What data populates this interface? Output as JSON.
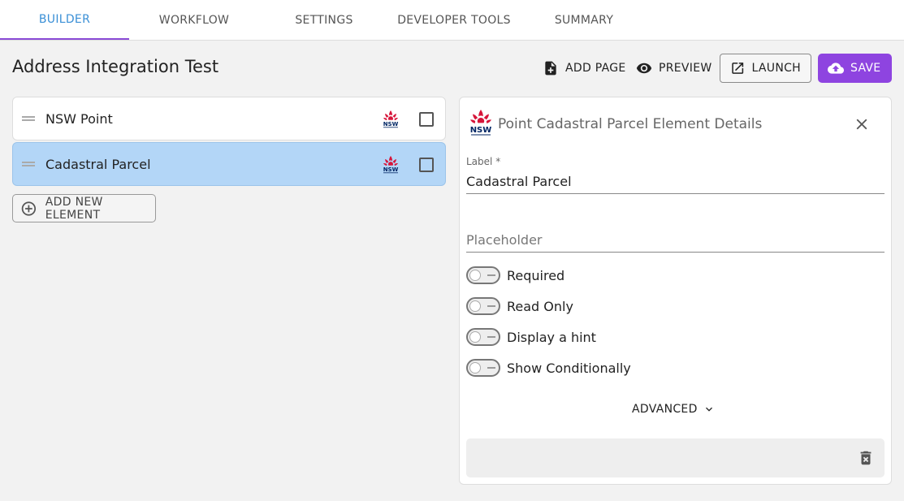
{
  "tabs": [
    {
      "label": "BUILDER"
    },
    {
      "label": "WORKFLOW"
    },
    {
      "label": "SETTINGS"
    },
    {
      "label": "DEVELOPER TOOLS"
    },
    {
      "label": "SUMMARY"
    }
  ],
  "header": {
    "title": "Address Integration Test",
    "add_page": "ADD PAGE",
    "preview": "PREVIEW",
    "launch": "LAUNCH",
    "save": "SAVE"
  },
  "elements": [
    {
      "label": "NSW Point",
      "icon": "nsw-logo-icon"
    },
    {
      "label": "Cadastral Parcel",
      "icon": "nsw-logo-icon"
    }
  ],
  "add_element": "ADD NEW ELEMENT",
  "details": {
    "title": "Point Cadastral Parcel Element Details",
    "label_field_label": "Label *",
    "label_value": "Cadastral Parcel",
    "placeholder_placeholder": "Placeholder",
    "toggles": [
      "Required",
      "Read Only",
      "Display a hint",
      "Show Conditionally"
    ],
    "advanced": "ADVANCED"
  },
  "colors": {
    "accent": "#8e44e0",
    "tab_active": "#3a8fd6",
    "selected_row": "#b3d6f7",
    "nsw_red": "#d7153a",
    "nsw_navy": "#002664"
  }
}
